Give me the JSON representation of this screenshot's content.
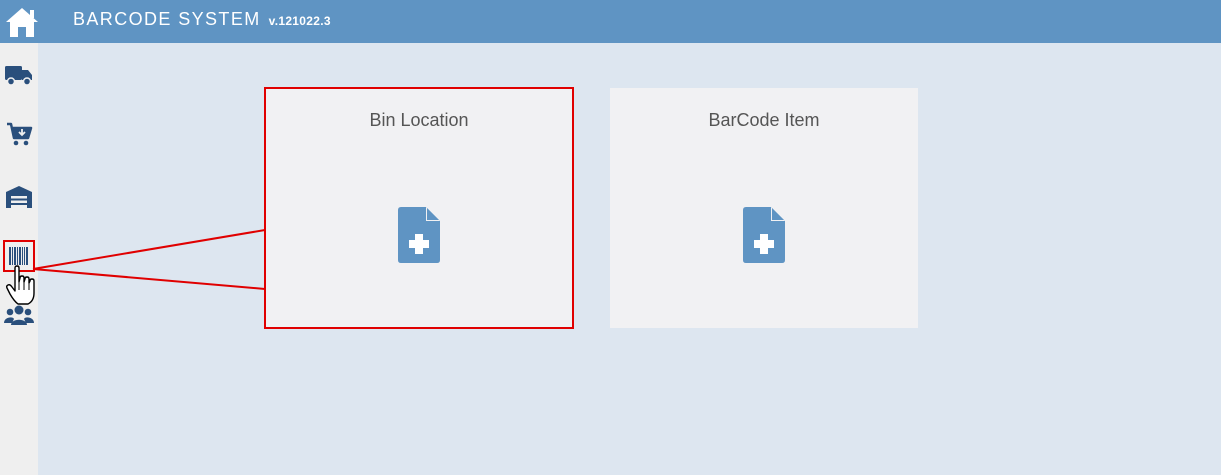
{
  "header": {
    "title": "BARCODE SYSTEM",
    "version": "v.121022.3",
    "home_icon": "home-icon",
    "background": "#5f94c3"
  },
  "sidebar": {
    "items": [
      {
        "name": "shipping",
        "icon": "truck-icon"
      },
      {
        "name": "receiving",
        "icon": "cart-download-icon"
      },
      {
        "name": "warehouse",
        "icon": "warehouse-icon"
      },
      {
        "name": "barcode",
        "icon": "barcode-icon",
        "highlighted": true
      },
      {
        "name": "users",
        "icon": "users-icon"
      }
    ]
  },
  "main": {
    "cards": [
      {
        "title": "Bin Location",
        "icon": "file-plus-icon",
        "selected": true
      },
      {
        "title": "BarCode Item",
        "icon": "file-plus-icon",
        "selected": false
      }
    ]
  },
  "colors": {
    "accent": "#5f94c3",
    "icon": "#2a4f7c",
    "highlight": "#e00000",
    "content_bg": "#dde6f0",
    "card_bg": "#f1f1f3"
  }
}
